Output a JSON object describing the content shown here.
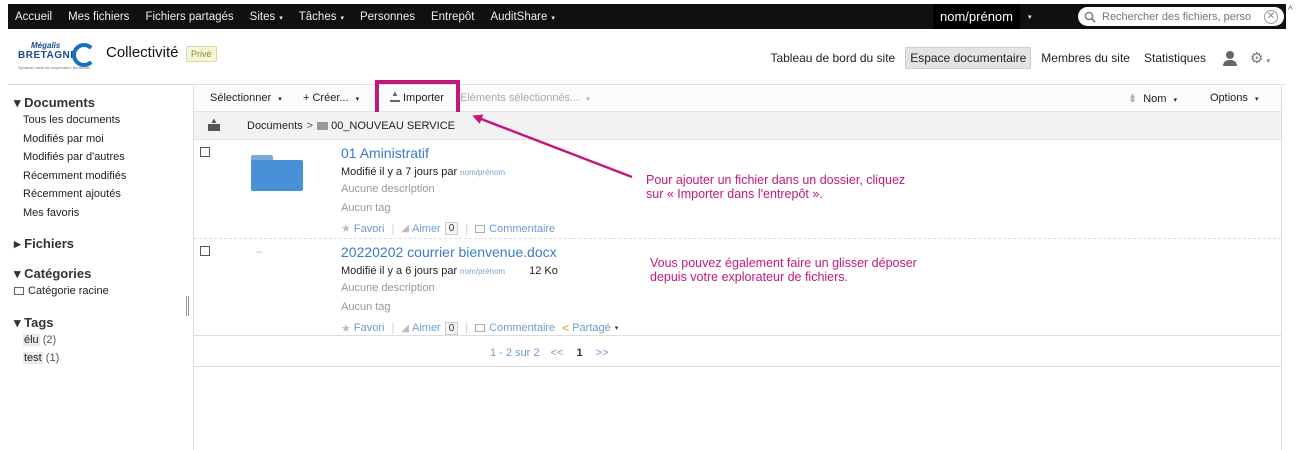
{
  "topnav": {
    "items": [
      {
        "label": "Accueil",
        "caret": ""
      },
      {
        "label": "Mes fichiers",
        "caret": ""
      },
      {
        "label": "Fichiers partagés",
        "caret": ""
      },
      {
        "label": "Sites",
        "caret": "▾"
      },
      {
        "label": "Tâches",
        "caret": "▾"
      },
      {
        "label": "Personnes",
        "caret": ""
      },
      {
        "label": "Entrepôt",
        "caret": ""
      },
      {
        "label": "AuditShare",
        "caret": "▾"
      }
    ],
    "user": "nom/prénom",
    "search_placeholder": "Rechercher des fichiers, perso"
  },
  "site": {
    "logo_top": "Mégalis",
    "logo_main": "BRETAGNE",
    "logo_sub": "Syndicat mixte de coopération territoriale",
    "title": "Collectivité",
    "visibility": "Privé",
    "nav": [
      "Tableau de bord du site",
      "Espace documentaire",
      "Membres du site",
      "Statistiques"
    ],
    "active_nav": "Espace documentaire"
  },
  "sidebar": {
    "documents_head": "▾ Documents",
    "documents": [
      "Tous les documents",
      "Modifiés par moi",
      "Modifiés par d'autres",
      "Récemment modifiés",
      "Récemment ajoutés",
      "Mes favoris"
    ],
    "fichiers_head": "▸ Fichiers",
    "categories_head": "▾ Catégories",
    "categories": [
      "Catégorie racine"
    ],
    "tags_head": "▾ Tags",
    "tags": [
      {
        "name": "élu",
        "count": "(2)"
      },
      {
        "name": "test",
        "count": "(1)"
      }
    ]
  },
  "toolbar": {
    "select": "Sélectionner",
    "create": "+ Créer...",
    "import": "Importer",
    "selected_items": "Eléments sélectionnés...",
    "sort": "Nom",
    "options": "Options",
    "caret": "▾"
  },
  "breadcrumb": {
    "root": "Documents",
    "separator": ">",
    "current": "00_NOUVEAU SERVICE"
  },
  "rows": [
    {
      "title": "01 Aministratif",
      "modified": "Modifié il y a 7 jours par",
      "by": "nom/prénom",
      "size": "",
      "description": "Aucune description",
      "tags": "Aucun tag",
      "favorite": "Favori",
      "like": "Aimer",
      "like_count": "0",
      "comment": "Commentaire",
      "share": ""
    },
    {
      "title": "20220202 courrier bienvenue.docx",
      "modified": "Modifié il y a 6 jours par",
      "by": "nom/prénom",
      "size": "12 Ko",
      "description": "Aucune description",
      "tags": "Aucun tag",
      "favorite": "Favori",
      "like": "Aimer",
      "like_count": "0",
      "comment": "Commentaire",
      "share": "Partagé"
    }
  ],
  "pager": {
    "info": "1 - 2 sur 2",
    "prev": "<<",
    "current": "1",
    "next": ">>"
  },
  "annotations": {
    "a1_line1": "Pour ajouter un fichier dans un dossier, cliquez",
    "a1_line2": "sur « Importer dans l'entrepôt ».",
    "a2_line1": "Vous pouvez également faire un glisser déposer",
    "a2_line2": "depuis votre explorateur de fichiers.",
    "color": "#c2187c"
  },
  "colors": {
    "topbar": "#101010",
    "link": "#3a7bc8",
    "folder": "#4a90d9",
    "share": "#e38a1c"
  }
}
